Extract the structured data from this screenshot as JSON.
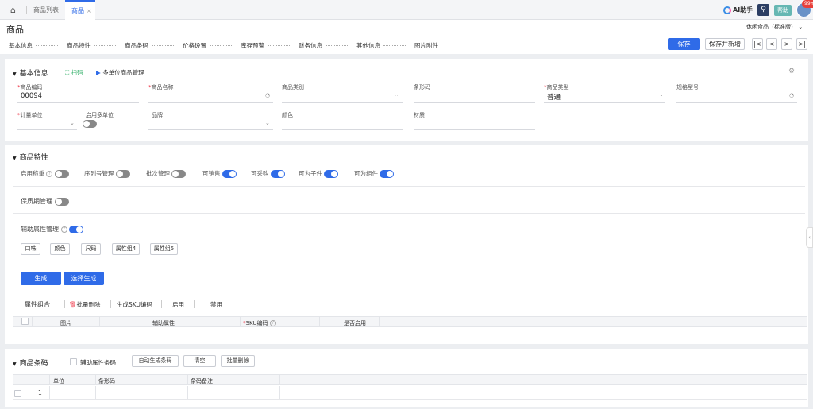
{
  "tabs": {
    "list": "商品列表",
    "active": "商品",
    "close": "×"
  },
  "topbar": {
    "ai": "AI助手",
    "help": "帮助",
    "badge": "99+"
  },
  "page": {
    "title": "商品",
    "store": "休闲食品（标准版）"
  },
  "steps": [
    "基本信息",
    "商品特性",
    "商品条码",
    "价格设置",
    "库存预警",
    "财务信息",
    "其他信息",
    "图片附件"
  ],
  "actions": {
    "save": "保存",
    "save_new": "保存并新增",
    "first": "|<",
    "prev": "<",
    "next": ">",
    "last": ">|"
  },
  "basic": {
    "title": "基本信息",
    "scan": "扫码",
    "multi_unit": "多单位商品管理",
    "code_label": "商品编码",
    "code_value": "00094",
    "name_label": "商品名称",
    "category_label": "商品类别",
    "barcode_label": "条形码",
    "type_label": "商品类型",
    "type_value": "普通",
    "spec_label": "规格型号",
    "unit_label": "计量单位",
    "multi_unit_label": "启用多单位",
    "brand_label": "品牌",
    "color_label": "颜色",
    "material_label": "材质"
  },
  "features": {
    "title": "商品特性",
    "weigh": "启用称重",
    "serial": "序列号管理",
    "batch": "批次管理",
    "sellable": "可销售",
    "purchasable": "可采购",
    "child": "可为子件",
    "component": "可为组件",
    "shelf_life": "保质期管理",
    "aux": "辅助属性管理",
    "attrs": [
      "口味",
      "颜色",
      "尺码",
      "属性组4",
      "属性组5"
    ],
    "generate": "生成",
    "select_generate": "选择生成",
    "combo_tab": "属性组合",
    "batch_delete": "批量删除",
    "gen_sku": "生成SKU编码",
    "enable": "启用",
    "disable": "禁用",
    "cols": {
      "image": "图片",
      "aux_attr": "辅助属性",
      "sku": "SKU编码",
      "enabled": "是否启用"
    }
  },
  "barcodes": {
    "title": "商品条码",
    "aux_barcode": "辅助属性条码",
    "auto_gen": "自动生成条码",
    "clear": "清空",
    "batch_delete": "批量删除",
    "cols": {
      "unit": "单位",
      "barcode": "条形码",
      "remark": "条码备注"
    },
    "row_no": "1"
  }
}
